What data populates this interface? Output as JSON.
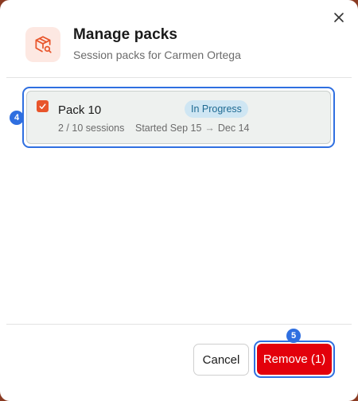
{
  "dialog": {
    "title": "Manage packs",
    "subtitle": "Session packs for Carmen Ortega",
    "header_icon": "package-search-icon",
    "close_icon": "close-icon"
  },
  "packs": [
    {
      "name": "Pack 10",
      "checked": true,
      "status": "In Progress",
      "sessions": "2 / 10 sessions",
      "started": "Started Sep 15",
      "arrow": "→",
      "ends": "Dec 14"
    }
  ],
  "markers": {
    "pack_marker": "4",
    "remove_marker": "5"
  },
  "footer": {
    "cancel_label": "Cancel",
    "remove_label": "Remove (1)"
  },
  "colors": {
    "accent": "#e8552b",
    "danger": "#e3000b",
    "focus": "#2f6fe0",
    "badge_bg": "#cfe6f3",
    "badge_text": "#1e6a92"
  }
}
